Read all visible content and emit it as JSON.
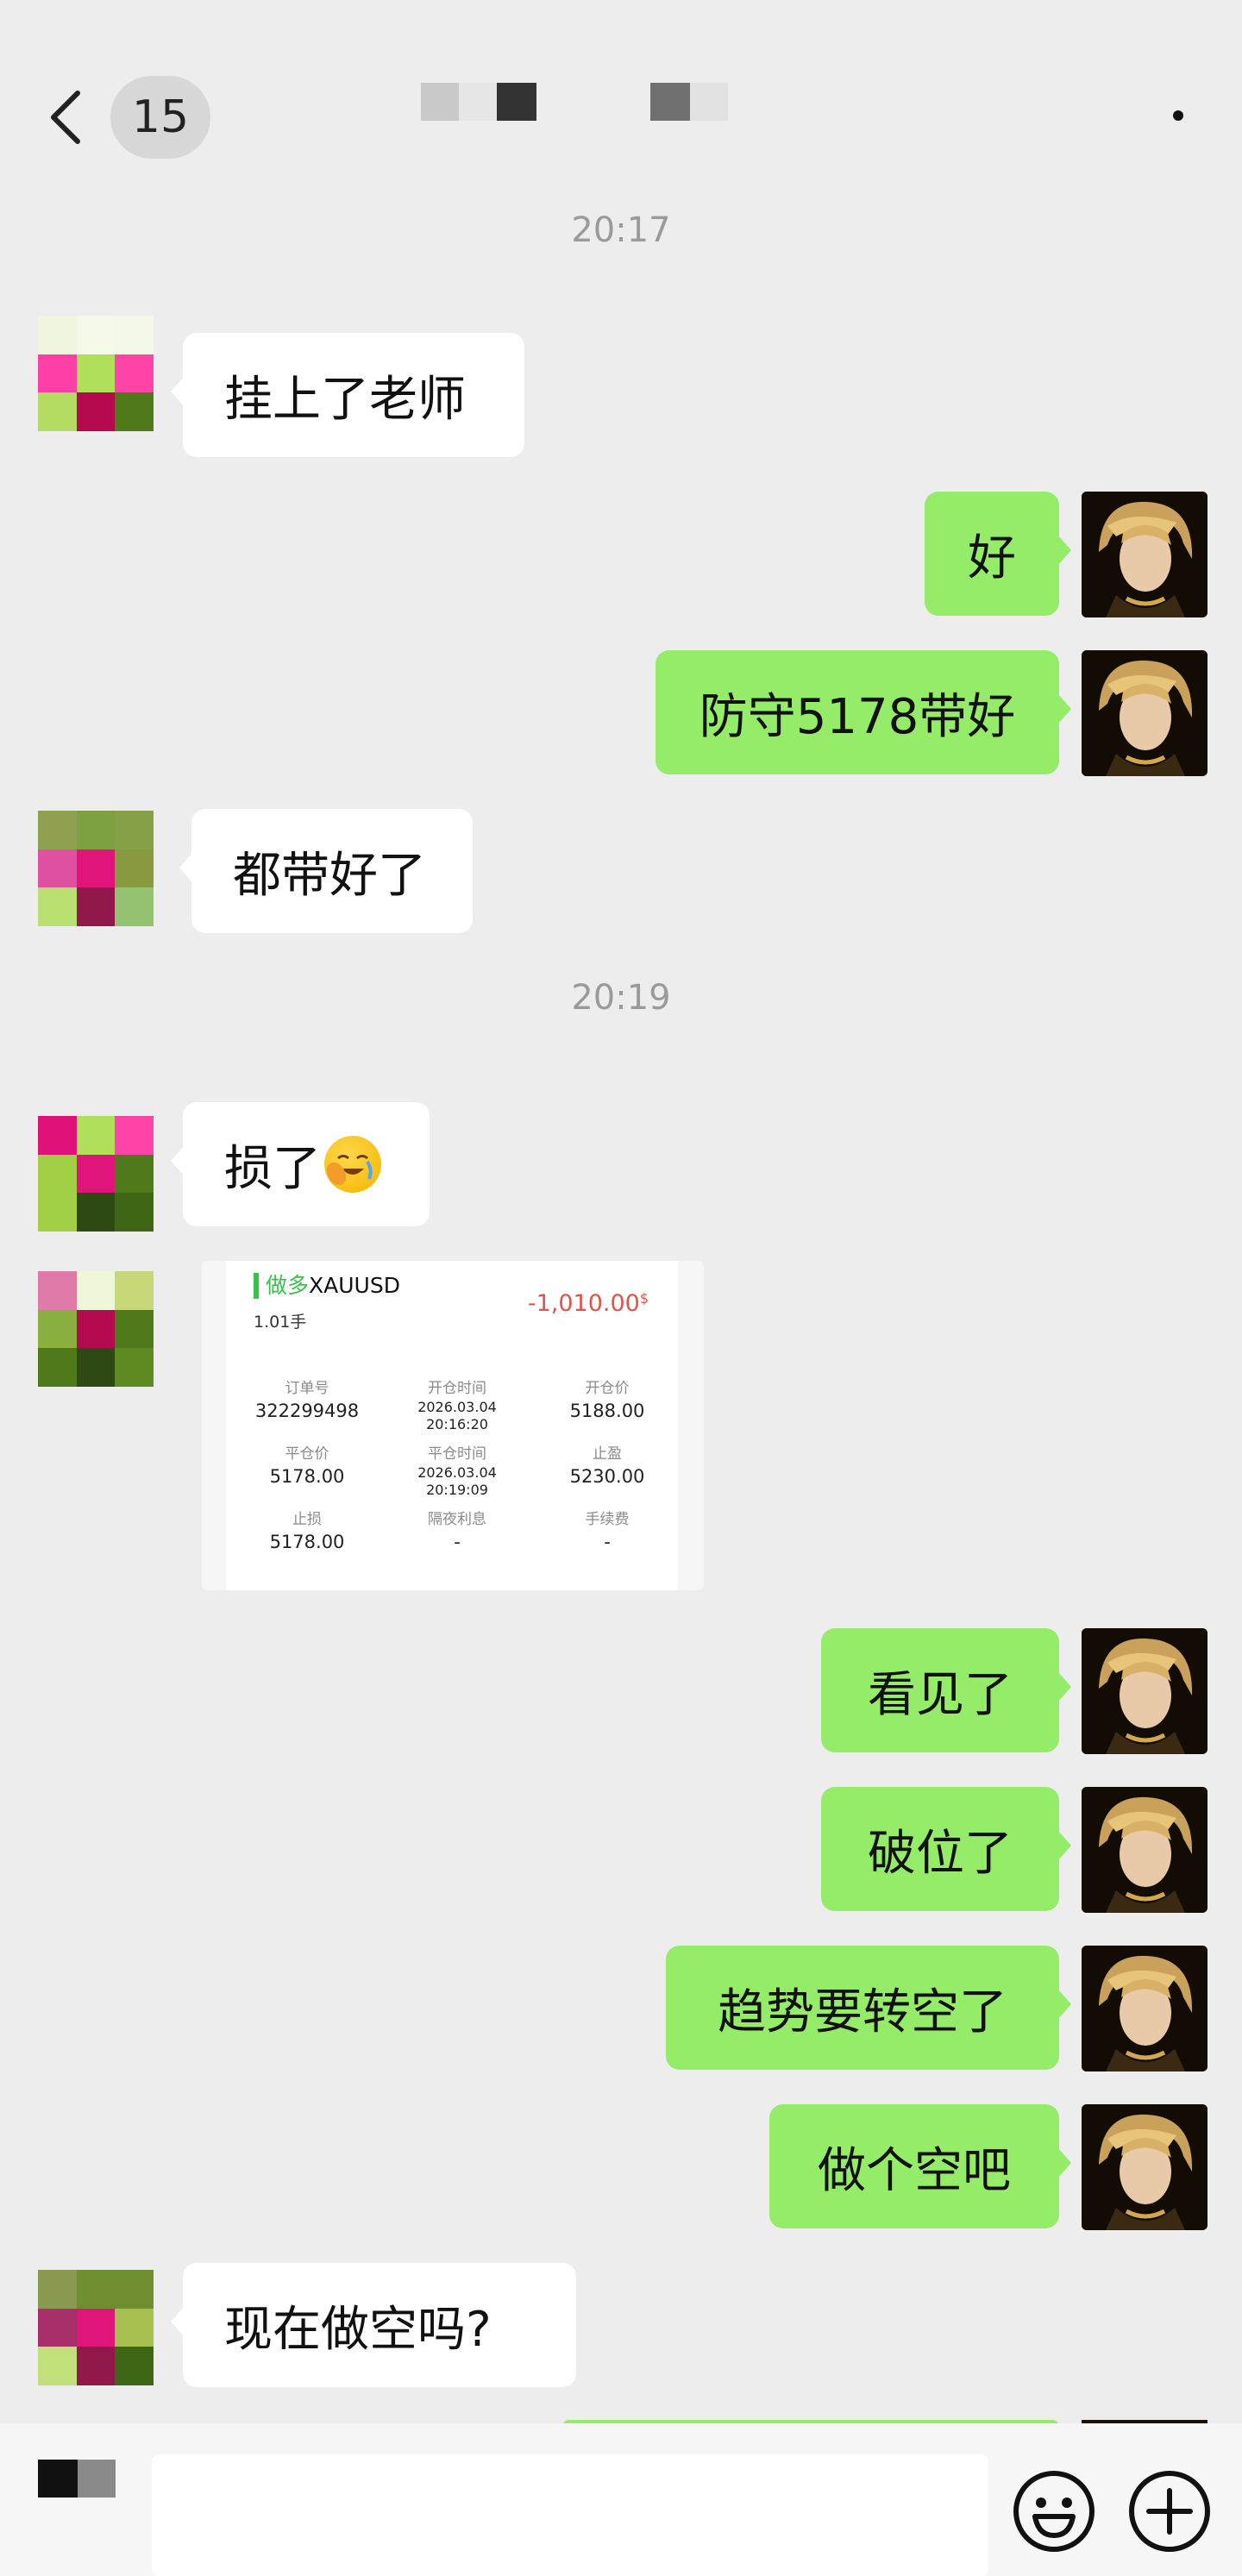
{
  "header": {
    "unread_count": "15",
    "title_blur_colors": [
      "#c9c9c9",
      "#e6e6e6",
      "#333333",
      "#6f6f6f",
      "#e2e2e2"
    ]
  },
  "colors": {
    "background": "#ededed",
    "incoming_bubble": "#ffffff",
    "outgoing_bubble": "#95ec69",
    "timestamp": "#9a9a9a",
    "loss": "#e0534a",
    "long_side": "#35c44a"
  },
  "messages": {
    "ts1": "20:17",
    "m1": "挂上了老师",
    "m2": "好",
    "m3": "防守5178带好",
    "m4": "都带好了",
    "ts2": "20:19",
    "m5": "损了",
    "m5_emoji": "face-with-hand-over-mouth-crying-emoji",
    "m7": "看见了",
    "m8": "破位了",
    "m9": "趋势要转空了",
    "m10": "做个空吧",
    "m11": "现在做空吗?"
  },
  "trade": {
    "side": "做多",
    "symbol": "XAUUSD",
    "lots": "1.01手",
    "pnl": "-1,010.00",
    "pnl_unit": "$",
    "fields": [
      {
        "label": "订单号",
        "value": "322299498"
      },
      {
        "label": "开仓时间",
        "value": "2026.03.04 20:16:20"
      },
      {
        "label": "开仓价",
        "value": "5188.00"
      },
      {
        "label": "平仓价",
        "value": "5178.00"
      },
      {
        "label": "平仓时间",
        "value": "2026.03.04 20:19:09"
      },
      {
        "label": "止盈",
        "value": "5230.00"
      },
      {
        "label": "止损",
        "value": "5178.00"
      },
      {
        "label": "隔夜利息",
        "value": "-"
      },
      {
        "label": "手续费",
        "value": "-"
      }
    ]
  },
  "avatars": {
    "contact_1": [
      "#f0f5e0",
      "#f5f9e8",
      "#f4f8e6",
      "#ff3fa8",
      "#b0df5a",
      "#ff44a8",
      "#b3dc62",
      "#b40a50",
      "#4e7a1a"
    ],
    "contact_1b": [
      "#a5d04a",
      "#2e4a12",
      "#3d6615",
      "#a5d04a",
      "#2e4a12",
      "#3d6615",
      "#a5d04a",
      "#2e4a12",
      "#3d6615"
    ],
    "contact_2": [
      "#8fa050",
      "#7da040",
      "#86a048",
      "#e050a0",
      "#e0157a",
      "#889a40",
      "#b8e070",
      "#90184a",
      "#94c270"
    ],
    "contact_3": [
      "#e0127a",
      "#b0df5a",
      "#ff44a8",
      "#a2d045",
      "#e0157a",
      "#4e7a1a",
      "#a2d045",
      "#2e4a12",
      "#3d6615"
    ],
    "contact_4": [
      "#e07aa8",
      "#eef8d8",
      "#c8d878",
      "#8cb040",
      "#b40a50",
      "#4e7a1a",
      "#4e7a1a",
      "#2e4a12",
      "#5e8a22"
    ],
    "contact_5": [
      "#8a9a50",
      "#6f8e30",
      "#6f8e30",
      "#a8306a",
      "#e0157a",
      "#a8c050",
      "#c2e07a",
      "#90184a",
      "#3d6615"
    ],
    "self_avatar": "gold-haired-portrait-avatar"
  },
  "input": {
    "left_blur_colors": [
      "#111111",
      "#8a8a8a"
    ],
    "emoji_icon": "smiley-icon",
    "plus_icon": "plus-circle-icon"
  }
}
